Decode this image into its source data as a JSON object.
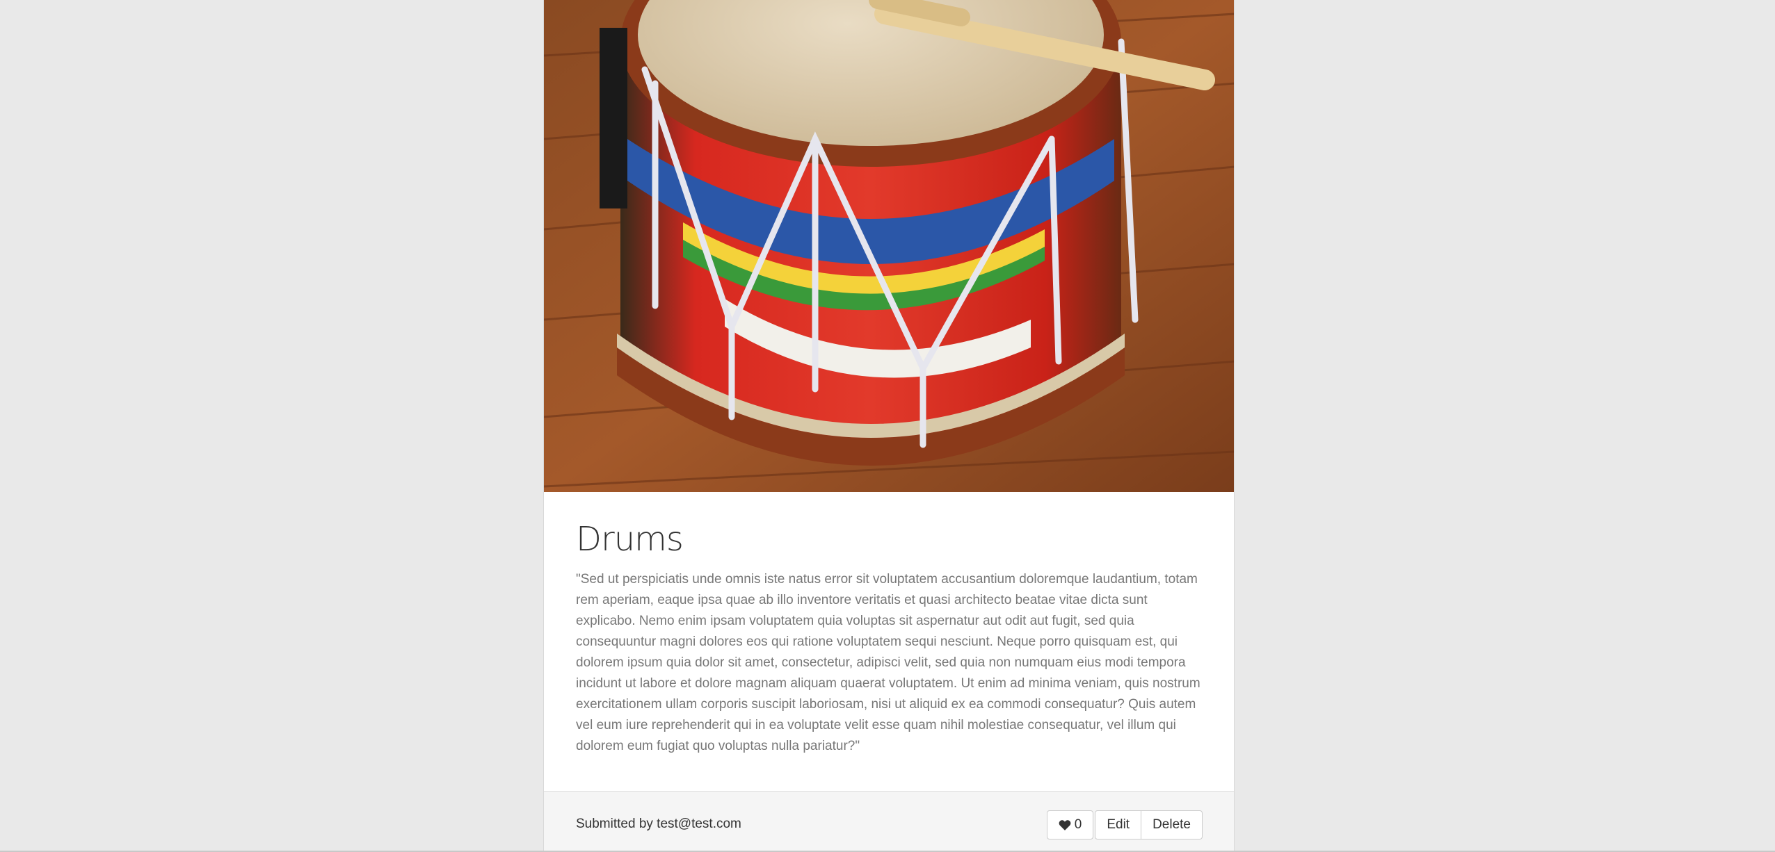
{
  "post": {
    "title": "Drums",
    "image_alt": "Drum with drumstick on wooden floor",
    "description": "\"Sed ut perspiciatis unde omnis iste natus error sit voluptatem accusantium doloremque laudantium, totam rem aperiam, eaque ipsa quae ab illo inventore veritatis et quasi architecto beatae vitae dicta sunt explicabo. Nemo enim ipsam voluptatem quia voluptas sit aspernatur aut odit aut fugit, sed quia consequuntur magni dolores eos qui ratione voluptatem sequi nesciunt. Neque porro quisquam est, qui dolorem ipsum quia dolor sit amet, consectetur, adipisci velit, sed quia non numquam eius modi tempora incidunt ut labore et dolore magnam aliquam quaerat voluptatem. Ut enim ad minima veniam, quis nostrum exercitationem ullam corporis suscipit laboriosam, nisi ut aliquid ex ea commodi consequatur? Quis autem vel eum iure reprehenderit qui in ea voluptate velit esse quam nihil molestiae consequatur, vel illum qui dolorem eum fugiat quo voluptas nulla pariatur?\""
  },
  "footer": {
    "submitted": "Submitted by test@test.com",
    "like_icon": "heart-icon",
    "like_count": "0",
    "edit_label": "Edit",
    "delete_label": "Delete"
  },
  "colors": {
    "page_bg": "#e9e9e9",
    "card_bg": "#ffffff",
    "footer_bg": "#f5f5f5",
    "text_muted": "#777777"
  }
}
